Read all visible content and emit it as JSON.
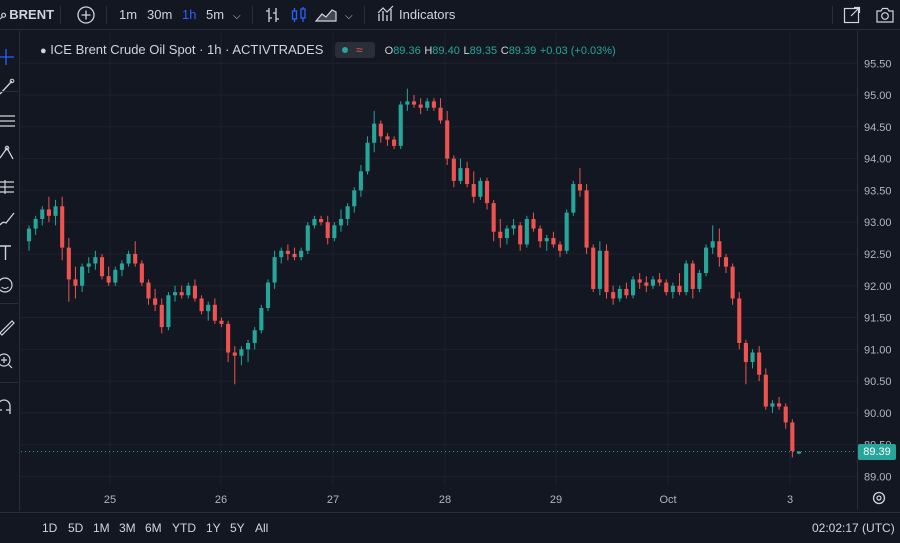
{
  "topbar": {
    "symbol": "BRENT",
    "intervals": [
      "1m",
      "30m",
      "1h",
      "5m"
    ],
    "active_interval": "1h",
    "indicators_label": "Indicators"
  },
  "legend": {
    "title": "ICE Brent Crude Oil Spot · 1h · ACTIVTRADES",
    "o_label": "O",
    "o_value": "89.36",
    "h_label": "H",
    "h_value": "89.40",
    "l_label": "L",
    "l_value": "89.35",
    "c_label": "C",
    "c_value": "89.39",
    "change": "+0.03 (+0.03%)"
  },
  "price_axis": {
    "ticks": [
      "95.50",
      "95.00",
      "94.50",
      "94.00",
      "93.50",
      "93.00",
      "92.50",
      "92.00",
      "91.50",
      "91.00",
      "90.50",
      "90.00",
      "89.50",
      "89.00"
    ],
    "last_price": "89.39"
  },
  "time_axis": {
    "ticks": [
      "25",
      "26",
      "27",
      "28",
      "29",
      "Oct",
      "3"
    ]
  },
  "bottombar": {
    "ranges": [
      "1D",
      "5D",
      "1M",
      "3M",
      "6M",
      "YTD",
      "1Y",
      "5Y",
      "All"
    ],
    "clock": "02:02:17 (UTC)"
  },
  "colors": {
    "up": "#26a69a",
    "down": "#ef5350",
    "background": "#131722",
    "accent": "#2962ff"
  },
  "chart_data": {
    "type": "candlestick",
    "ylim": [
      88.85,
      95.85
    ],
    "points": [
      [
        92.7,
        92.95,
        92.55,
        92.9
      ],
      [
        92.9,
        93.1,
        92.8,
        93.05
      ],
      [
        93.05,
        93.25,
        92.95,
        93.2
      ],
      [
        93.2,
        93.4,
        93.0,
        93.1
      ],
      [
        93.1,
        93.35,
        92.95,
        93.25
      ],
      [
        93.25,
        93.4,
        92.4,
        92.6
      ],
      [
        92.6,
        92.75,
        91.75,
        92.1
      ],
      [
        92.1,
        92.3,
        91.8,
        92.0
      ],
      [
        92.0,
        92.35,
        91.9,
        92.3
      ],
      [
        92.3,
        92.45,
        92.2,
        92.35
      ],
      [
        92.35,
        92.55,
        92.25,
        92.45
      ],
      [
        92.45,
        92.5,
        92.1,
        92.15
      ],
      [
        92.15,
        92.3,
        92.0,
        92.05
      ],
      [
        92.05,
        92.3,
        92.0,
        92.25
      ],
      [
        92.25,
        92.4,
        92.15,
        92.35
      ],
      [
        92.35,
        92.55,
        92.3,
        92.5
      ],
      [
        92.5,
        92.7,
        92.3,
        92.35
      ],
      [
        92.35,
        92.4,
        92.0,
        92.05
      ],
      [
        92.05,
        92.1,
        91.7,
        91.8
      ],
      [
        91.8,
        91.95,
        91.6,
        91.7
      ],
      [
        91.7,
        91.8,
        91.25,
        91.35
      ],
      [
        91.35,
        91.9,
        91.3,
        91.85
      ],
      [
        91.85,
        92.0,
        91.75,
        91.9
      ],
      [
        91.9,
        92.0,
        91.8,
        91.85
      ],
      [
        91.85,
        92.05,
        91.8,
        92.0
      ],
      [
        92.0,
        92.1,
        91.75,
        91.8
      ],
      [
        91.8,
        91.85,
        91.55,
        91.6
      ],
      [
        91.6,
        91.75,
        91.45,
        91.7
      ],
      [
        91.7,
        91.8,
        91.4,
        91.45
      ],
      [
        91.45,
        91.5,
        91.35,
        91.4
      ],
      [
        91.4,
        91.45,
        90.8,
        90.95
      ],
      [
        90.95,
        91.05,
        90.45,
        90.9
      ],
      [
        90.9,
        91.05,
        90.75,
        91.0
      ],
      [
        91.0,
        91.15,
        90.8,
        91.1
      ],
      [
        91.1,
        91.35,
        91.0,
        91.3
      ],
      [
        91.3,
        91.7,
        91.25,
        91.65
      ],
      [
        91.65,
        92.1,
        91.6,
        92.05
      ],
      [
        92.05,
        92.55,
        91.95,
        92.45
      ],
      [
        92.45,
        92.6,
        92.35,
        92.55
      ],
      [
        92.55,
        92.65,
        92.4,
        92.5
      ],
      [
        92.5,
        92.6,
        92.4,
        92.45
      ],
      [
        92.45,
        92.6,
        92.4,
        92.55
      ],
      [
        92.55,
        93.0,
        92.5,
        92.95
      ],
      [
        92.95,
        93.1,
        92.9,
        93.05
      ],
      [
        93.05,
        93.1,
        92.95,
        93.0
      ],
      [
        93.0,
        93.1,
        92.65,
        92.75
      ],
      [
        92.75,
        93.0,
        92.7,
        92.95
      ],
      [
        92.95,
        93.2,
        92.85,
        93.05
      ],
      [
        93.05,
        93.3,
        92.95,
        93.25
      ],
      [
        93.25,
        93.55,
        93.15,
        93.5
      ],
      [
        93.5,
        93.9,
        93.4,
        93.8
      ],
      [
        93.8,
        94.35,
        93.75,
        94.25
      ],
      [
        94.25,
        94.75,
        94.1,
        94.55
      ],
      [
        94.55,
        94.6,
        94.25,
        94.35
      ],
      [
        94.35,
        94.4,
        94.2,
        94.3
      ],
      [
        94.3,
        94.35,
        94.15,
        94.2
      ],
      [
        94.2,
        94.9,
        94.15,
        94.85
      ],
      [
        94.85,
        95.1,
        94.75,
        94.9
      ],
      [
        94.9,
        95.0,
        94.8,
        94.85
      ],
      [
        94.85,
        94.95,
        94.7,
        94.8
      ],
      [
        94.8,
        94.95,
        94.75,
        94.9
      ],
      [
        94.9,
        94.95,
        94.75,
        94.8
      ],
      [
        94.8,
        94.95,
        94.55,
        94.6
      ],
      [
        94.6,
        94.75,
        93.9,
        94.0
      ],
      [
        94.0,
        94.05,
        93.55,
        93.65
      ],
      [
        93.65,
        94.0,
        93.6,
        93.85
      ],
      [
        93.85,
        93.95,
        93.55,
        93.6
      ],
      [
        93.6,
        93.8,
        93.3,
        93.4
      ],
      [
        93.4,
        93.7,
        93.35,
        93.65
      ],
      [
        93.65,
        93.7,
        93.2,
        93.3
      ],
      [
        93.3,
        93.35,
        92.7,
        92.85
      ],
      [
        92.85,
        93.05,
        92.6,
        92.75
      ],
      [
        92.75,
        92.95,
        92.65,
        92.9
      ],
      [
        92.9,
        93.05,
        92.8,
        92.95
      ],
      [
        92.95,
        93.0,
        92.55,
        92.65
      ],
      [
        92.65,
        93.1,
        92.6,
        93.05
      ],
      [
        93.05,
        93.15,
        92.85,
        92.9
      ],
      [
        92.9,
        92.95,
        92.6,
        92.7
      ],
      [
        92.7,
        92.8,
        92.55,
        92.75
      ],
      [
        92.75,
        92.85,
        92.6,
        92.65
      ],
      [
        92.65,
        92.7,
        92.45,
        92.55
      ],
      [
        92.55,
        93.2,
        92.5,
        93.15
      ],
      [
        93.15,
        93.65,
        93.1,
        93.6
      ],
      [
        93.6,
        93.85,
        93.4,
        93.5
      ],
      [
        93.5,
        93.6,
        92.5,
        92.6
      ],
      [
        92.6,
        92.65,
        91.9,
        91.95
      ],
      [
        91.95,
        92.7,
        91.85,
        92.55
      ],
      [
        92.55,
        92.65,
        91.8,
        91.9
      ],
      [
        91.9,
        92.0,
        91.7,
        91.8
      ],
      [
        91.8,
        92.0,
        91.75,
        91.95
      ],
      [
        91.95,
        92.05,
        91.8,
        91.85
      ],
      [
        91.85,
        92.15,
        91.8,
        92.1
      ],
      [
        92.1,
        92.2,
        91.95,
        92.05
      ],
      [
        92.05,
        92.15,
        91.9,
        92.0
      ],
      [
        92.0,
        92.15,
        91.95,
        92.1
      ],
      [
        92.1,
        92.2,
        92.0,
        92.05
      ],
      [
        92.05,
        92.1,
        91.85,
        91.9
      ],
      [
        91.9,
        92.05,
        91.8,
        92.0
      ],
      [
        92.0,
        92.2,
        91.85,
        91.9
      ],
      [
        91.9,
        92.4,
        91.85,
        92.35
      ],
      [
        92.35,
        92.4,
        91.8,
        91.95
      ],
      [
        91.95,
        92.25,
        91.9,
        92.2
      ],
      [
        92.2,
        92.65,
        92.15,
        92.6
      ],
      [
        92.6,
        92.95,
        92.5,
        92.7
      ],
      [
        92.7,
        92.9,
        92.3,
        92.45
      ],
      [
        92.45,
        92.5,
        92.2,
        92.3
      ],
      [
        92.3,
        92.35,
        91.7,
        91.8
      ],
      [
        91.8,
        91.9,
        91.0,
        91.1
      ],
      [
        91.1,
        91.15,
        90.45,
        90.8
      ],
      [
        90.8,
        91.0,
        90.7,
        90.95
      ],
      [
        90.95,
        91.05,
        90.5,
        90.6
      ],
      [
        90.6,
        90.7,
        90.05,
        90.1
      ],
      [
        90.1,
        90.2,
        90.0,
        90.15
      ],
      [
        90.15,
        90.25,
        90.05,
        90.1
      ],
      [
        90.1,
        90.15,
        89.75,
        89.85
      ],
      [
        89.85,
        89.9,
        89.3,
        89.4
      ],
      [
        89.36,
        89.4,
        89.35,
        89.39
      ]
    ]
  }
}
